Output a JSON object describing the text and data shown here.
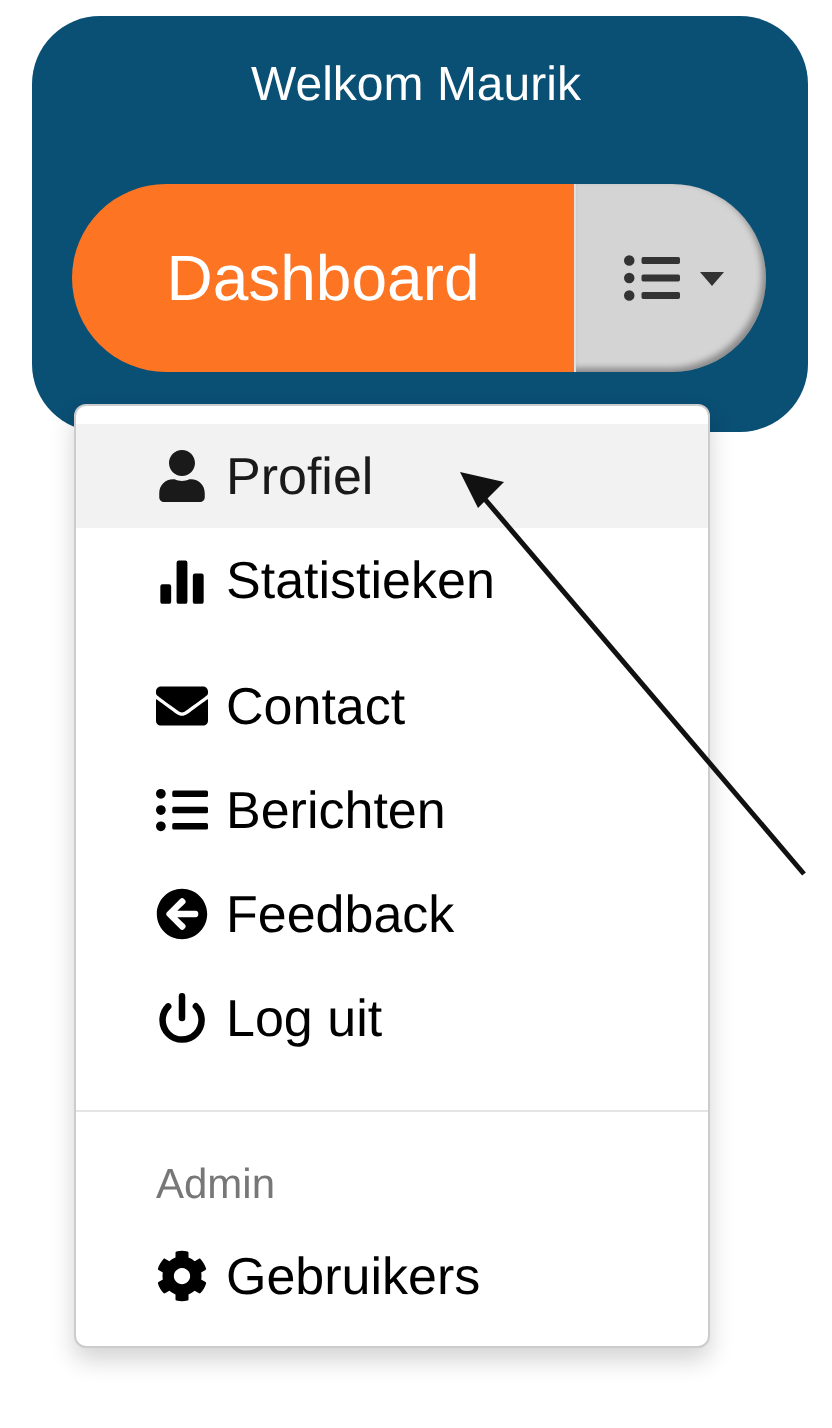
{
  "header": {
    "title": "Welkom Maurik"
  },
  "dashboard_button": {
    "label": "Dashboard"
  },
  "menu": [
    {
      "kind": "item",
      "label": "Profiel",
      "selected": true
    },
    {
      "kind": "item",
      "label": "Statistieken",
      "selected": false
    },
    {
      "kind": "item",
      "label": "Contact",
      "selected": false
    },
    {
      "kind": "item",
      "label": "Berichten",
      "selected": false
    },
    {
      "kind": "item",
      "label": "Feedback",
      "selected": false
    },
    {
      "kind": "item",
      "label": "Log uit",
      "selected": false
    },
    {
      "kind": "divider"
    },
    {
      "kind": "header",
      "label": "Admin"
    },
    {
      "kind": "item",
      "label": "Gebruikers",
      "selected": false
    }
  ]
}
